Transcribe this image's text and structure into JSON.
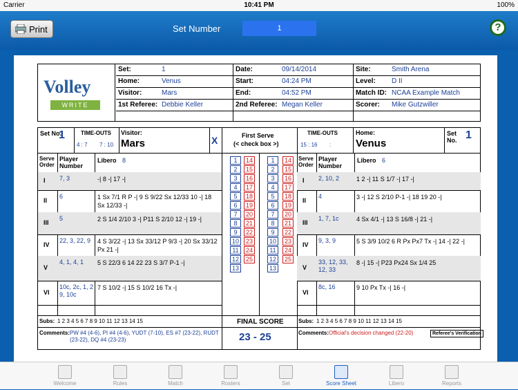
{
  "status": {
    "carrier": "Carrier",
    "time": "10:41 PM",
    "battery": "100%"
  },
  "toolbar": {
    "print": "Print",
    "set_label": "Set Number",
    "set_value": "1",
    "help": "?"
  },
  "header": {
    "set_label": "Set:",
    "set": "1",
    "date_label": "Date:",
    "date": "09/14/2014",
    "site_label": "Site:",
    "site": "Smith Arena",
    "home_label": "Home:",
    "home": "Venus",
    "start_label": "Start:",
    "start": "04:24 PM",
    "level_label": "Level:",
    "level": "D II",
    "visitor_label": "Visitor:",
    "visitor": "Mars",
    "end_label": "End:",
    "end": "04:52 PM",
    "match_label": "Match ID:",
    "match": "NCAA Example Match",
    "ref1_label": "1st Referee:",
    "ref1": "Debbie Keller",
    "ref2_label": "2nd Referee:",
    "ref2": "Megan Keller",
    "scorer_label": "Scorer:",
    "scorer": "Mike Gutzwiller"
  },
  "logo": {
    "top": "Volley",
    "bottom": "WRITE"
  },
  "left": {
    "set_no_label": "Set No.",
    "set_no": "1",
    "timeouts_label": "TIME-OUTS",
    "timeouts": [
      "4 : 7",
      "7 : 10"
    ],
    "team_label": "Visitor:",
    "team": "Mars",
    "x": "X",
    "serve_label": "Serve Order",
    "player_label": "Player Number",
    "libero_label": "Libero",
    "libero": "8",
    "rows": [
      {
        "order": "I",
        "players": "7, 3",
        "serves": "-| 8 -| 17 -|"
      },
      {
        "order": "II",
        "players": "6",
        "serves": "1 Sx 7/1 R P -| 9 S 9/22 Sx 12/33 10 -| 18 Sx 12/33 -|"
      },
      {
        "order": "III",
        "players": "5",
        "serves": "2 S 1/4 2/10 3 -| P11 S 2/10 12 -| 19 -|"
      },
      {
        "order": "IV",
        "players": "22, 3, 22, 9",
        "serves": "4 S 3/22 -| 13 Sx 33/12 P 9/3 -| 20 Sx 33/12 Px 21 -|"
      },
      {
        "order": "V",
        "players": "4, 1, 4, 1",
        "serves": "5 S 22/3 6 14 22 23 S 3/7 P-1 -|"
      },
      {
        "order": "VI",
        "players": "10c, 2c, 1, 2 9, 10c",
        "serves": "7 S 10/2 -| 15 S 10/2 16 Tx -|"
      }
    ],
    "subs_label": "Subs:",
    "subs": "1 2 3 4 5 6 7 8 9 10 11 12 13 14 15",
    "comments_label": "Comments:",
    "comments": "PW #4 (4-6), PI #4 (4-6), YUDT (7-10), ES #7 (23-22), RUDT (23-22), DQ #4 (23-23)"
  },
  "middle": {
    "first_serve": "First Serve",
    "check": "(< check box >)",
    "final_label": "FINAL SCORE",
    "final": "23 - 25",
    "col1": [
      "1",
      "2",
      "3",
      "4",
      "5",
      "6",
      "7",
      "8",
      "9",
      "10",
      "11",
      "12",
      "13"
    ],
    "col2": [
      "14",
      "15",
      "16",
      "17",
      "18",
      "19",
      "20",
      "21",
      "22",
      "23",
      "24",
      "25"
    ],
    "col3": [
      "1",
      "2",
      "3",
      "4",
      "5",
      "6",
      "7",
      "8",
      "9",
      "10",
      "11",
      "12",
      "13"
    ],
    "col4": [
      "14",
      "15",
      "16",
      "17",
      "18",
      "19",
      "20",
      "21",
      "22",
      "23",
      "24",
      "25"
    ]
  },
  "right": {
    "set_no_label": "Set No.",
    "set_no": "1",
    "timeouts_label": "TIME-OUTS",
    "timeouts": [
      "15 : 16",
      ":"
    ],
    "team_label": "Home:",
    "team": "Venus",
    "serve_label": "Serve Order",
    "player_label": "Player Number",
    "libero_label": "Libero",
    "libero": "6",
    "rows": [
      {
        "order": "I",
        "players": "2, 10, 2",
        "serves": "1 2 -| 11 S 1/7 -| 17 -|"
      },
      {
        "order": "II",
        "players": "4",
        "serves": "3 -| 12 S 2/10 P-1 -| 18 19 20 -|"
      },
      {
        "order": "III",
        "players": "1, 7, 1c",
        "serves": "4 Sx 4/1 -| 13 S 16/8 -| 21 -|"
      },
      {
        "order": "IV",
        "players": "9, 3, 9",
        "serves": "5 S 3/9 10/2 6 R Px Px7 Tx -| 14 -| 22 -|"
      },
      {
        "order": "V",
        "players": "33, 12, 33, 12, 33",
        "serves": "8 -| 15 -| P23 Px24 Sx 1/4 25"
      },
      {
        "order": "VI",
        "players": "8c, 16",
        "serves": "9 10 Px Tx -| 16 -|"
      }
    ],
    "subs_label": "Subs:",
    "subs": "1 2 3 4 5 6 7 8 9 10 11 12 13 14 15",
    "comments_label": "Comments:",
    "comments": "Official's decision changed (22-20)",
    "verify": "Referee's Verification"
  },
  "tabs": [
    "Welcome",
    "Rules",
    "Match",
    "Rosters",
    "Set",
    "Score Sheet",
    "Libero",
    "Reports"
  ],
  "active_tab": "Score Sheet"
}
